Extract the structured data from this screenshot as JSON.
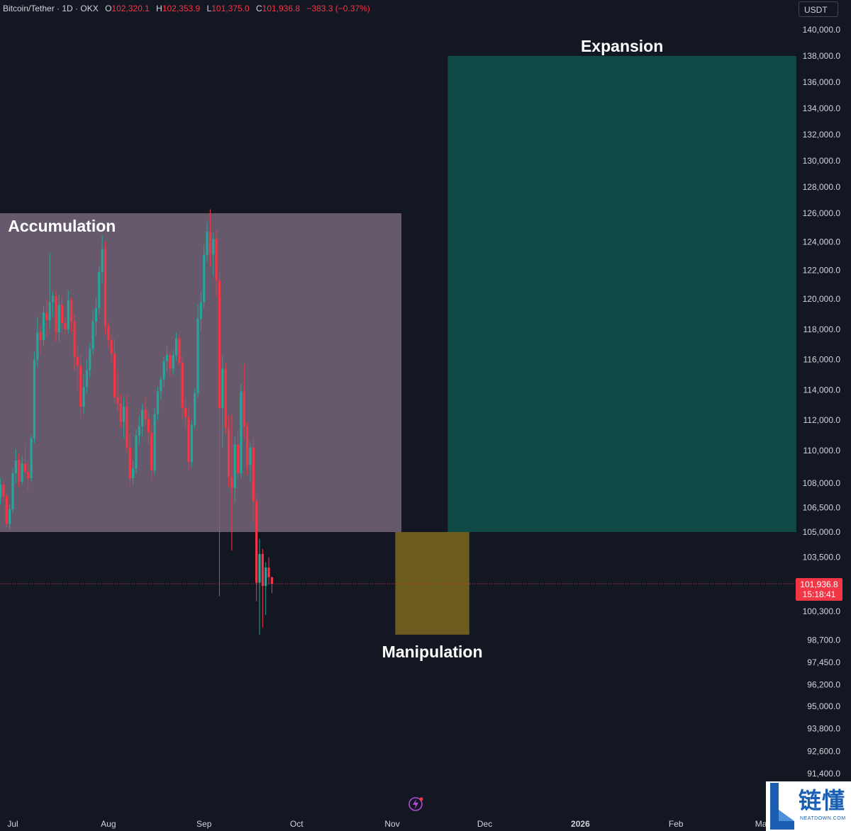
{
  "header": {
    "symbol": "Bitcoin/Tether · 1D · OKX",
    "open_label": "O",
    "open_value": "102,320.1",
    "high_label": "H",
    "high_value": "102,353.9",
    "low_label": "L",
    "low_value": "101,375.0",
    "close_label": "C",
    "close_value": "101,936.8",
    "change": "−383.3 (−0.37%)"
  },
  "currency": "USDT",
  "current_price": {
    "price": "101,936.8",
    "countdown": "15:18:41"
  },
  "colors": {
    "background": "#131722",
    "up": "#26a69a",
    "down": "#f23645",
    "accumulation_zone": "#66596c",
    "manipulation_zone": "#6b5b1f",
    "expansion_zone": "#0f4a46"
  },
  "icons": {
    "replay": "lightning-replay-icon",
    "watermark": "neatdown-logo"
  },
  "watermark": {
    "text_cn": "链懂",
    "text_en": "NEATDOWN.COM"
  },
  "chart_data": {
    "type": "candlestick",
    "series": [
      {
        "name": "BTC/USDT",
        "start": "2025-06-26"
      }
    ],
    "ylabels": [
      "140,000.0",
      "138,000.0",
      "136,000.0",
      "134,000.0",
      "132,000.0",
      "130,000.0",
      "128,000.0",
      "126,000.0",
      "124,000.0",
      "122,000.0",
      "120,000.0",
      "118,000.0",
      "116,000.0",
      "114,000.0",
      "112,000.0",
      "110,000.0",
      "108,000.0",
      "106,500.0",
      "105,000.0",
      "103,500.0",
      "100,300.0",
      "98,700.0",
      "97,450.0",
      "96,200.0",
      "95,000.0",
      "93,800.0",
      "92,600.0",
      "91,400.0"
    ],
    "xlabels": [
      "Jul",
      "Aug",
      "Sep",
      "Oct",
      "Nov",
      "Dec",
      "2026",
      "Feb",
      "Mar"
    ],
    "ohlc": [
      [
        106200,
        107500,
        105600,
        107100
      ],
      [
        107100,
        108300,
        106700,
        107900
      ],
      [
        107900,
        108100,
        106900,
        107200
      ],
      [
        107200,
        107400,
        105300,
        105500
      ],
      [
        105500,
        106700,
        105200,
        106400
      ],
      [
        106400,
        108900,
        106200,
        108600
      ],
      [
        108600,
        110100,
        108000,
        109400
      ],
      [
        109400,
        109800,
        107800,
        108100
      ],
      [
        108100,
        109700,
        107900,
        109200
      ],
      [
        109200,
        110300,
        108500,
        108700
      ],
      [
        108700,
        109400,
        107600,
        108300
      ],
      [
        108300,
        111000,
        108100,
        110800
      ],
      [
        110800,
        116500,
        110500,
        116000
      ],
      [
        116000,
        118800,
        115500,
        117800
      ],
      [
        117800,
        118300,
        116300,
        117300
      ],
      [
        117300,
        119500,
        116900,
        119100
      ],
      [
        119100,
        120000,
        117500,
        118600
      ],
      [
        118600,
        123200,
        118000,
        119800
      ],
      [
        119800,
        120500,
        118800,
        120200
      ],
      [
        120200,
        120600,
        117200,
        117800
      ],
      [
        117800,
        120300,
        117200,
        119600
      ],
      [
        119600,
        120200,
        117800,
        118400
      ],
      [
        118400,
        118800,
        117600,
        118000
      ],
      [
        118000,
        120600,
        117700,
        119900
      ],
      [
        119900,
        120100,
        117800,
        118500
      ],
      [
        118500,
        119000,
        115300,
        116200
      ],
      [
        116200,
        117000,
        114000,
        115600
      ],
      [
        115600,
        116300,
        112100,
        112900
      ],
      [
        112900,
        115000,
        112400,
        114200
      ],
      [
        114200,
        116000,
        113800,
        115300
      ],
      [
        115300,
        117100,
        114800,
        116700
      ],
      [
        116700,
        119300,
        116300,
        118500
      ],
      [
        118500,
        120100,
        117600,
        119400
      ],
      [
        119400,
        122300,
        119000,
        121900
      ],
      [
        121900,
        124500,
        121100,
        123500
      ],
      [
        123500,
        124000,
        117700,
        118200
      ],
      [
        118200,
        118500,
        116800,
        117300
      ],
      [
        117300,
        117600,
        115800,
        116400
      ],
      [
        116400,
        117400,
        113100,
        113500
      ],
      [
        113500,
        115300,
        112600,
        113100
      ],
      [
        113100,
        113700,
        111500,
        111900
      ],
      [
        111900,
        113500,
        110800,
        112900
      ],
      [
        112900,
        113700,
        109900,
        110200
      ],
      [
        110200,
        111100,
        107800,
        108300
      ],
      [
        108300,
        109400,
        107900,
        108900
      ],
      [
        108900,
        111400,
        108600,
        111000
      ],
      [
        111000,
        112300,
        110400,
        111600
      ],
      [
        111600,
        113100,
        110900,
        112700
      ],
      [
        112700,
        113500,
        111600,
        112100
      ],
      [
        112100,
        112700,
        110400,
        111200
      ],
      [
        111200,
        111700,
        108200,
        108800
      ],
      [
        108800,
        112800,
        108500,
        112400
      ],
      [
        112400,
        114200,
        112000,
        113900
      ],
      [
        113900,
        114900,
        113300,
        114700
      ],
      [
        114700,
        116200,
        114200,
        115900
      ],
      [
        115900,
        116900,
        115200,
        116300
      ],
      [
        116300,
        116600,
        114900,
        115400
      ],
      [
        115400,
        116600,
        115000,
        116300
      ],
      [
        116300,
        117800,
        115900,
        117400
      ],
      [
        117400,
        117600,
        115600,
        115800
      ],
      [
        115800,
        116200,
        112000,
        112800
      ],
      [
        112800,
        113400,
        111500,
        112200
      ],
      [
        112200,
        112900,
        108800,
        109300
      ],
      [
        109300,
        112000,
        109000,
        111700
      ],
      [
        111700,
        114100,
        111400,
        113800
      ],
      [
        113800,
        119600,
        113500,
        118700
      ],
      [
        118700,
        120500,
        117900,
        119800
      ],
      [
        119800,
        123800,
        119400,
        123100
      ],
      [
        123100,
        125400,
        122600,
        124700
      ],
      [
        124700,
        126300,
        122300,
        123100
      ],
      [
        123100,
        124600,
        121600,
        124200
      ],
      [
        124200,
        124800,
        120200,
        121300
      ],
      [
        121300,
        122000,
        101200,
        112800
      ],
      [
        112800,
        116300,
        110200,
        115400
      ],
      [
        115400,
        115800,
        111100,
        111500
      ],
      [
        111500,
        112300,
        107800,
        108400
      ],
      [
        108400,
        112400,
        103900,
        107700
      ],
      [
        107700,
        110900,
        106800,
        110400
      ],
      [
        110400,
        111300,
        108200,
        108600
      ],
      [
        108600,
        114400,
        108300,
        113900
      ],
      [
        113900,
        115700,
        110800,
        111600
      ],
      [
        111600,
        111900,
        108500,
        109100
      ],
      [
        109100,
        110500,
        108100,
        110200
      ],
      [
        110200,
        110800,
        105600,
        106900
      ],
      [
        106900,
        107300,
        100900,
        102000
      ],
      [
        102000,
        104600,
        99000,
        103700
      ],
      [
        103700,
        104000,
        99400,
        101800
      ],
      [
        101800,
        103200,
        100100,
        102900
      ],
      [
        102900,
        103500,
        101900,
        102320
      ],
      [
        102320,
        102354,
        101375,
        101937
      ]
    ],
    "annotations": [
      {
        "type": "rect",
        "label": "Accumulation",
        "from": "2025-06-26",
        "to": "2025-11-04",
        "y1": 105000,
        "y2": 126000
      },
      {
        "type": "rect",
        "label": "Manipulation",
        "from": "2025-11-02",
        "to": "2025-11-26",
        "y1": 99000,
        "y2": 105000
      },
      {
        "type": "rect",
        "label": "Expansion",
        "from": "2025-11-19",
        "to": "2026-03-12",
        "y1": 105000,
        "y2": 138000
      }
    ],
    "last_price": 101936.8
  }
}
